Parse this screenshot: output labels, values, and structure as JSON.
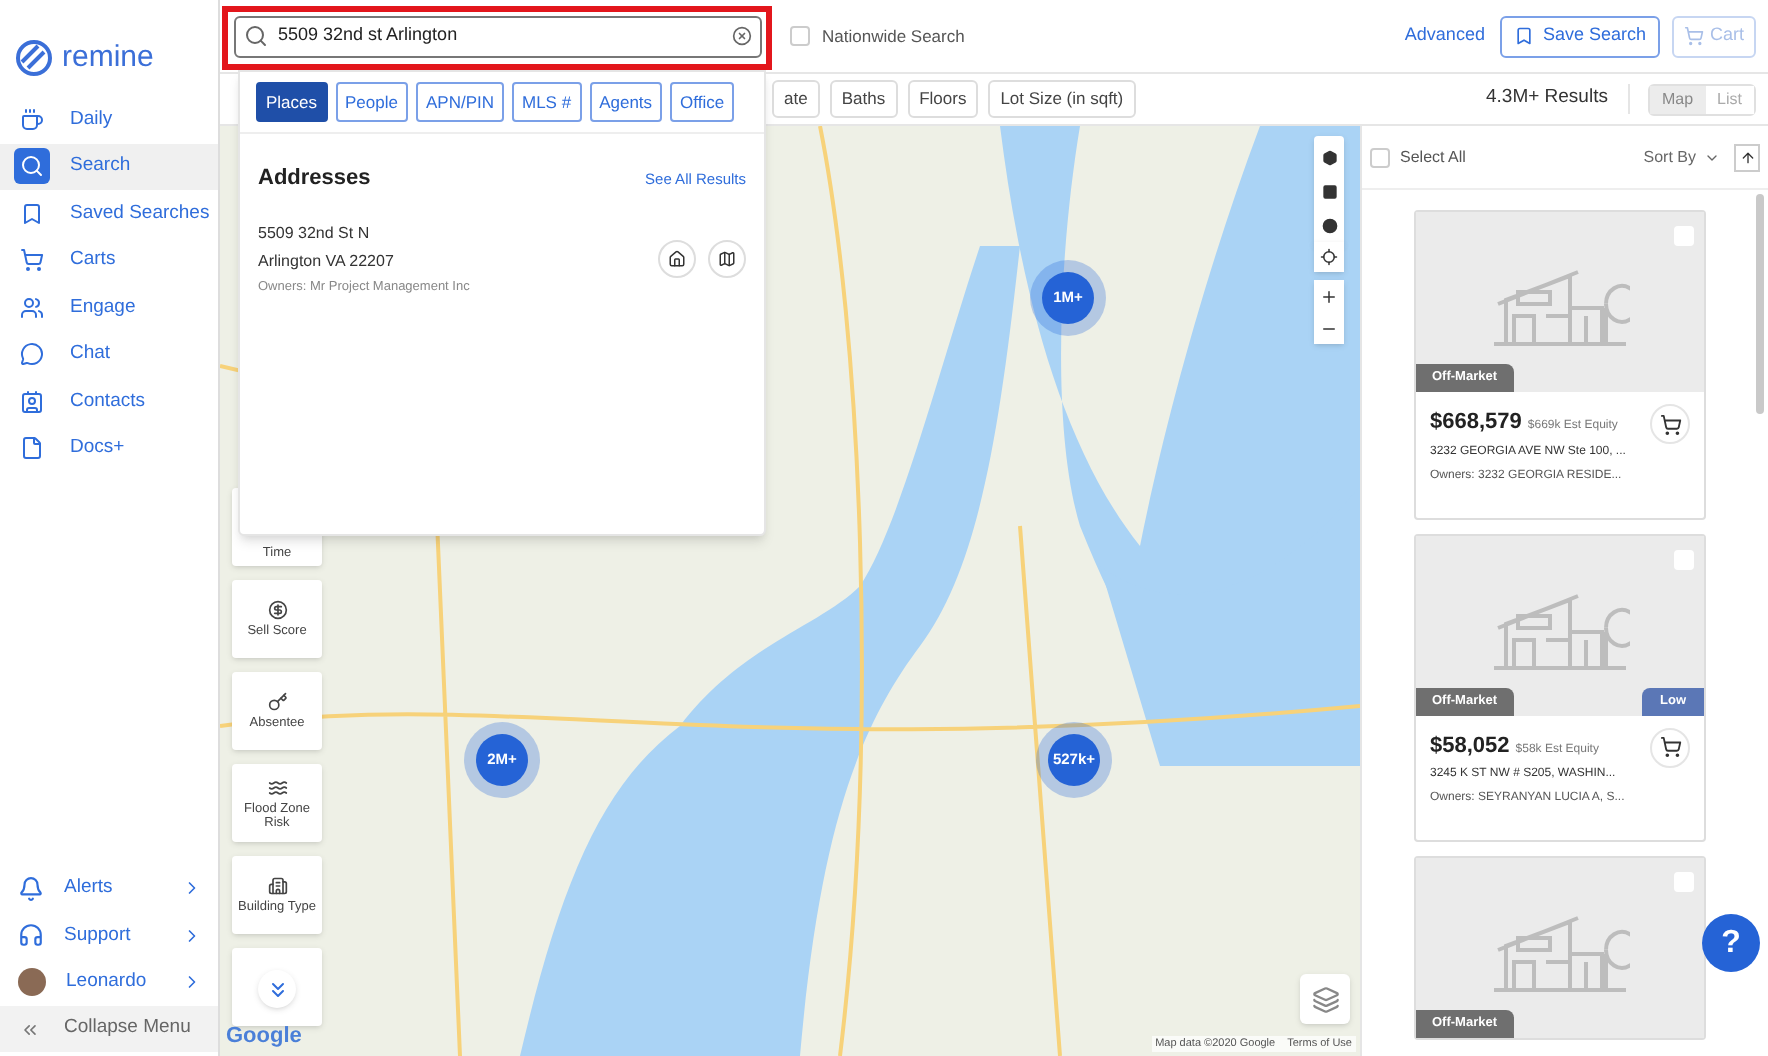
{
  "brand": {
    "name": "remine"
  },
  "sidebar": {
    "items": [
      {
        "label": "Daily",
        "selected": false
      },
      {
        "label": "Search",
        "selected": true
      },
      {
        "label": "Saved Searches",
        "selected": false
      },
      {
        "label": "Carts",
        "selected": false
      },
      {
        "label": "Engage",
        "selected": false
      },
      {
        "label": "Chat",
        "selected": false
      },
      {
        "label": "Contacts",
        "selected": false
      },
      {
        "label": "Docs+",
        "selected": false
      }
    ],
    "bottom_items": [
      {
        "label": "Alerts",
        "kind": "icon"
      },
      {
        "label": "Support",
        "kind": "icon"
      },
      {
        "label": "Leonardo",
        "kind": "avatar"
      }
    ],
    "collapse": {
      "label": "Collapse Menu"
    }
  },
  "search": {
    "value": "5509 32nd st Arlington",
    "highlighted": true
  },
  "nationwide": {
    "label": "Nationwide Search",
    "checked": false
  },
  "top_actions": {
    "advanced": "Advanced",
    "save_search": "Save Search",
    "cart": {
      "label": "Cart",
      "disabled": true
    }
  },
  "filters": [
    "ate",
    "Baths",
    "Floors",
    "Lot Size (in sqft)"
  ],
  "results_count": "4.3M+ Results",
  "view_toggle": [
    {
      "label": "Map",
      "selected": true
    },
    {
      "label": "List",
      "selected": false
    }
  ],
  "dropdown": {
    "tabs": [
      {
        "label": "Places",
        "selected": true
      },
      {
        "label": "People",
        "selected": false
      },
      {
        "label": "APN/PIN",
        "selected": false
      },
      {
        "label": "MLS #",
        "selected": false
      },
      {
        "label": "Agents",
        "selected": false
      },
      {
        "label": "Office",
        "selected": false
      }
    ],
    "heading": "Addresses",
    "see_all": "See All Results",
    "results": [
      {
        "line1": "5509 32nd St N",
        "line2": "Arlington VA 22207",
        "owners": "Owners: Mr Project Management Inc"
      }
    ]
  },
  "map": {
    "tools": [
      "Time",
      "Sell Score",
      "Absentee",
      "Flood Zone Risk",
      "Building Type"
    ],
    "clusters": [
      {
        "label": "1M+"
      },
      {
        "label": "2M+"
      },
      {
        "label": "527k+"
      }
    ],
    "logo": "Google",
    "attribution": "Map data ©2020 Google",
    "terms": "Terms of Use"
  },
  "list": {
    "select_all": {
      "label": "Select All",
      "checked": false
    },
    "sort": "Sort By",
    "cards": [
      {
        "status": "Off-Market",
        "checked": false,
        "price": "$668,579",
        "equity": "$669k Est Equity",
        "address": "3232 GEORGIA AVE NW Ste 100, ...",
        "owners": "Owners: 3232 GEORGIA RESIDE..."
      },
      {
        "status": "Off-Market",
        "badge": "Low",
        "checked": false,
        "price": "$58,052",
        "equity": "$58k Est Equity",
        "address": "3245 K ST NW # S205, WASHIN...",
        "owners": "Owners: SEYRANYAN LUCIA A, S..."
      },
      {
        "status": "Off-Market",
        "checked": false
      }
    ]
  },
  "help": "?"
}
